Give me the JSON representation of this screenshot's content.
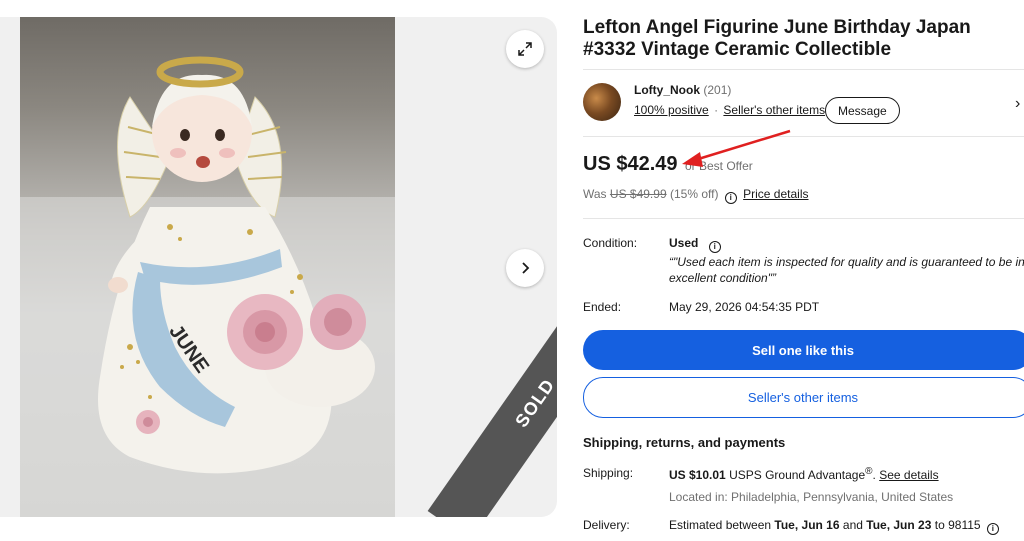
{
  "listing": {
    "title": "Lefton Angel Figurine June Birthday Japan #3332 Vintage Ceramic Collectible",
    "sold_label": "SOLD",
    "sash_text": "JUNE"
  },
  "seller": {
    "name": "Lofty_Nook",
    "feedback_count": "(201)",
    "positive": "100% positive",
    "other_items": "Seller's other items",
    "message_label": "Message"
  },
  "price": {
    "current": "US $42.49",
    "best_offer": "or Best Offer",
    "was_prefix": "Was",
    "was_value": "US $49.99",
    "discount": "(15% off)",
    "details_link": "Price details"
  },
  "condition": {
    "label": "Condition:",
    "value": "Used",
    "description": "“\"Used each item is inspected for quality and is guaranteed to be in excellent condition\"”"
  },
  "ended": {
    "label": "Ended:",
    "value": "May 29, 2026 04:54:35 PDT"
  },
  "actions": {
    "primary": "Sell one like this",
    "secondary": "Seller's other items"
  },
  "shipping": {
    "section_title": "Shipping, returns, and payments",
    "label": "Shipping:",
    "cost": "US $10.01",
    "service": "USPS Ground Advantage",
    "trademark": "®",
    "see_details": "See details",
    "location": "Located in: Philadelphia, Pennsylvania, United States"
  },
  "delivery": {
    "label": "Delivery:",
    "prefix": "Estimated between",
    "start": "Tue, Jun 16",
    "and": "and",
    "end": "Tue, Jun 23",
    "to": "to 98115"
  },
  "colors": {
    "primary_blue": "#1560e0",
    "sold_ribbon": "#555555",
    "annotation_arrow": "#e02020"
  },
  "icons": [
    "expand-icon",
    "chevron-right-icon",
    "info-icon",
    "annotation-arrow"
  ]
}
